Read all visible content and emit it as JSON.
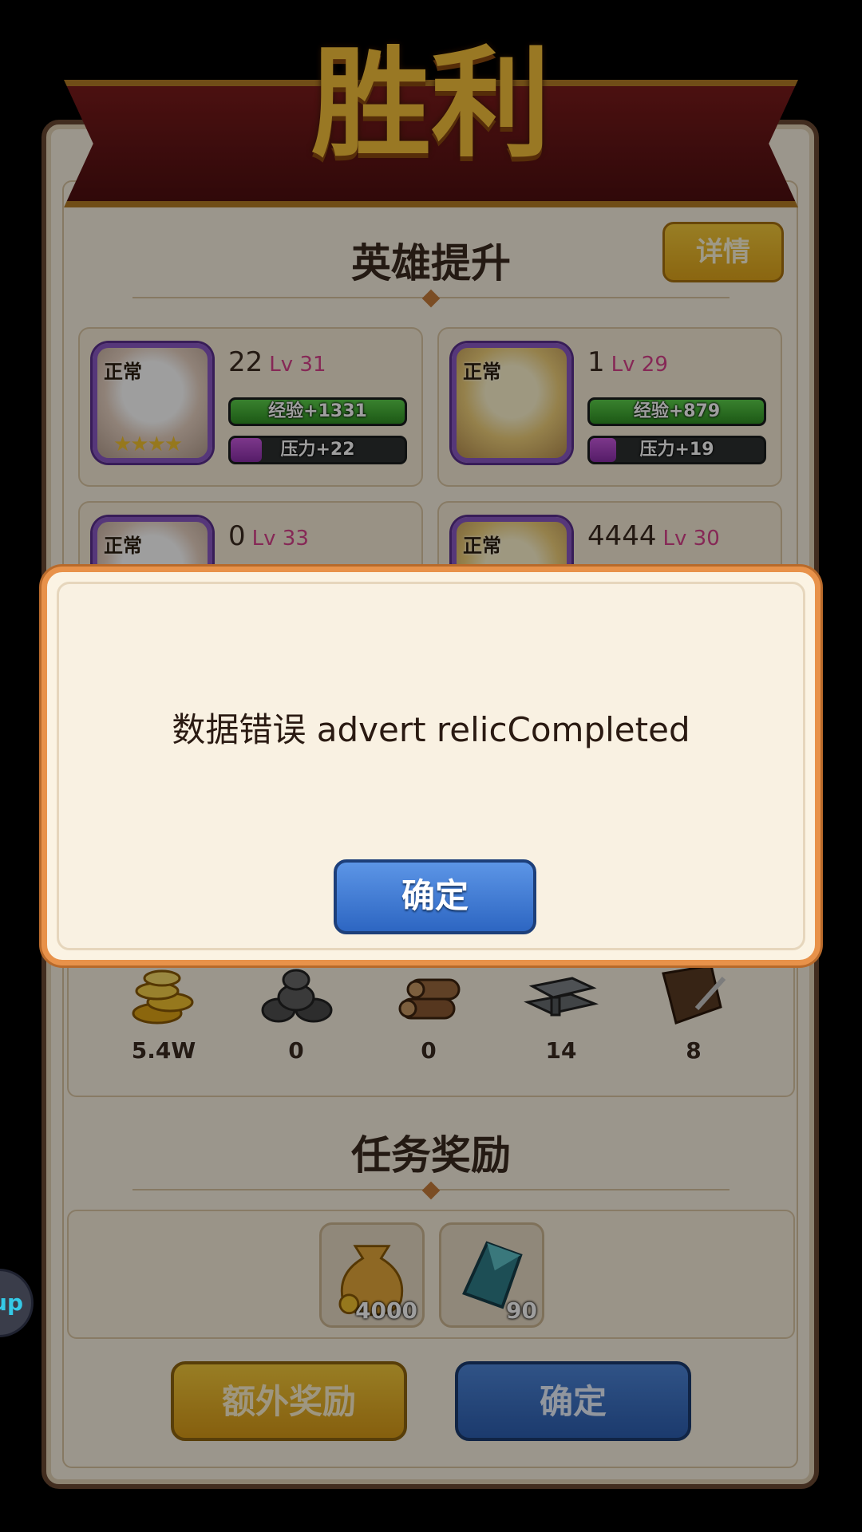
{
  "victory": {
    "title": "胜利",
    "hero_section_title": "英雄提升",
    "detail_button": "详情",
    "heroes": [
      {
        "status": "正常",
        "number": "22",
        "level": "Lv 31",
        "exp": "经验+1331",
        "exp_fill": 1.0,
        "pressure": "压力+22",
        "pressure_fill": 0.18,
        "stars": "★★★★"
      },
      {
        "status": "正常",
        "number": "1",
        "level": "Lv 29",
        "exp": "经验+879",
        "exp_fill": 1.0,
        "pressure": "压力+19",
        "pressure_fill": 0.15,
        "stars": ""
      },
      {
        "status": "正常",
        "number": "0",
        "level": "Lv 33"
      },
      {
        "status": "正常",
        "number": "4444",
        "level": "Lv 30"
      }
    ],
    "resources": [
      {
        "icon": "gold-coins-icon",
        "value": "5.4W"
      },
      {
        "icon": "stone-icon",
        "value": "0"
      },
      {
        "icon": "wood-logs-icon",
        "value": "0"
      },
      {
        "icon": "iron-ingots-icon",
        "value": "14"
      },
      {
        "icon": "leather-icon",
        "value": "8"
      }
    ],
    "task_section_title": "任务奖励",
    "task_rewards": [
      {
        "icon": "money-bag-icon",
        "qty": "4000"
      },
      {
        "icon": "crystal-icon",
        "qty": "90"
      }
    ],
    "extra_reward_button": "额外奖励",
    "confirm_button": "确定"
  },
  "side_button": "up",
  "dialog": {
    "message": "数据错误 advert relicCompleted",
    "confirm_button": "确定"
  }
}
